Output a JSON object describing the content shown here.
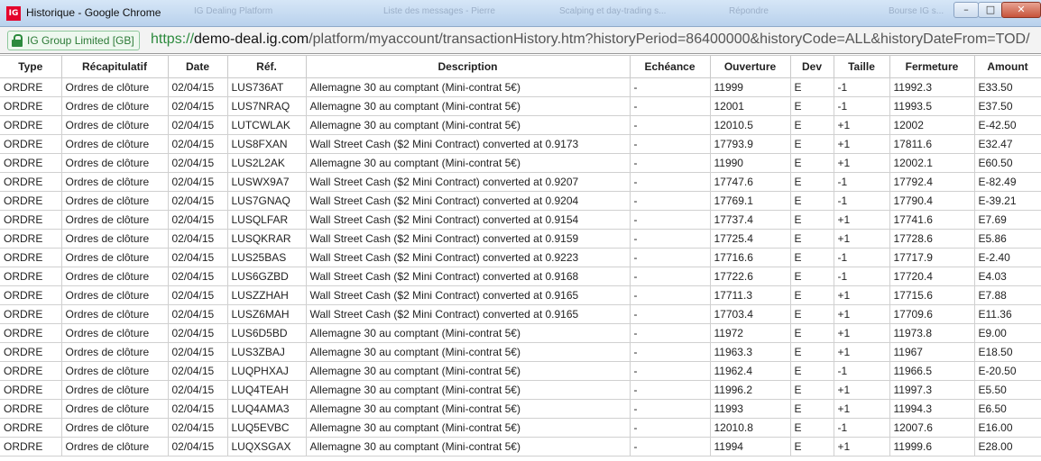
{
  "window": {
    "app_badge": "IG",
    "title": "Historique - Google Chrome",
    "ghost_tabs": [
      "IG Dealing Platform",
      "Liste des messages - Pierre",
      "Scalping et day-trading s...",
      "Répondre",
      "Bourse IG s..."
    ],
    "controls": {
      "minimize": "–",
      "maximize": "□",
      "close": "✕"
    }
  },
  "address_bar": {
    "secure_label": "IG Group Limited [GB]",
    "url_scheme": "https://",
    "url_host": "demo-deal.ig.com",
    "url_path": "/platform/myaccount/transactionHistory.htm?historyPeriod=86400000&historyCode=ALL&historyDateFrom=TOD/"
  },
  "table": {
    "headers": [
      "Type",
      "Récapitulatif",
      "Date",
      "Réf.",
      "Description",
      "Echéance",
      "Ouverture",
      "Dev",
      "Taille",
      "Fermeture",
      "Amount"
    ],
    "rows": [
      [
        "ORDRE",
        "Ordres de clôture",
        "02/04/15",
        "LUS736AT",
        "Allemagne 30 au comptant (Mini-contrat 5€)",
        "-",
        "11999",
        "E",
        "-1",
        "11992.3",
        "E33.50"
      ],
      [
        "ORDRE",
        "Ordres de clôture",
        "02/04/15",
        "LUS7NRAQ",
        "Allemagne 30 au comptant (Mini-contrat 5€)",
        "-",
        "12001",
        "E",
        "-1",
        "11993.5",
        "E37.50"
      ],
      [
        "ORDRE",
        "Ordres de clôture",
        "02/04/15",
        "LUTCWLAK",
        "Allemagne 30 au comptant (Mini-contrat 5€)",
        "-",
        "12010.5",
        "E",
        "+1",
        "12002",
        "E-42.50"
      ],
      [
        "ORDRE",
        "Ordres de clôture",
        "02/04/15",
        "LUS8FXAN",
        "Wall Street Cash ($2 Mini Contract) converted at 0.9173",
        "-",
        "17793.9",
        "E",
        "+1",
        "17811.6",
        "E32.47"
      ],
      [
        "ORDRE",
        "Ordres de clôture",
        "02/04/15",
        "LUS2L2AK",
        "Allemagne 30 au comptant (Mini-contrat 5€)",
        "-",
        "11990",
        "E",
        "+1",
        "12002.1",
        "E60.50"
      ],
      [
        "ORDRE",
        "Ordres de clôture",
        "02/04/15",
        "LUSWX9A7",
        "Wall Street Cash ($2 Mini Contract) converted at 0.9207",
        "-",
        "17747.6",
        "E",
        "-1",
        "17792.4",
        "E-82.49"
      ],
      [
        "ORDRE",
        "Ordres de clôture",
        "02/04/15",
        "LUS7GNAQ",
        "Wall Street Cash ($2 Mini Contract) converted at 0.9204",
        "-",
        "17769.1",
        "E",
        "-1",
        "17790.4",
        "E-39.21"
      ],
      [
        "ORDRE",
        "Ordres de clôture",
        "02/04/15",
        "LUSQLFAR",
        "Wall Street Cash ($2 Mini Contract) converted at 0.9154",
        "-",
        "17737.4",
        "E",
        "+1",
        "17741.6",
        "E7.69"
      ],
      [
        "ORDRE",
        "Ordres de clôture",
        "02/04/15",
        "LUSQKRAR",
        "Wall Street Cash ($2 Mini Contract) converted at 0.9159",
        "-",
        "17725.4",
        "E",
        "+1",
        "17728.6",
        "E5.86"
      ],
      [
        "ORDRE",
        "Ordres de clôture",
        "02/04/15",
        "LUS25BAS",
        "Wall Street Cash ($2 Mini Contract) converted at 0.9223",
        "-",
        "17716.6",
        "E",
        "-1",
        "17717.9",
        "E-2.40"
      ],
      [
        "ORDRE",
        "Ordres de clôture",
        "02/04/15",
        "LUS6GZBD",
        "Wall Street Cash ($2 Mini Contract) converted at 0.9168",
        "-",
        "17722.6",
        "E",
        "-1",
        "17720.4",
        "E4.03"
      ],
      [
        "ORDRE",
        "Ordres de clôture",
        "02/04/15",
        "LUSZZHAH",
        "Wall Street Cash ($2 Mini Contract) converted at 0.9165",
        "-",
        "17711.3",
        "E",
        "+1",
        "17715.6",
        "E7.88"
      ],
      [
        "ORDRE",
        "Ordres de clôture",
        "02/04/15",
        "LUSZ6MAH",
        "Wall Street Cash ($2 Mini Contract) converted at 0.9165",
        "-",
        "17703.4",
        "E",
        "+1",
        "17709.6",
        "E11.36"
      ],
      [
        "ORDRE",
        "Ordres de clôture",
        "02/04/15",
        "LUS6D5BD",
        "Allemagne 30 au comptant (Mini-contrat 5€)",
        "-",
        "11972",
        "E",
        "+1",
        "11973.8",
        "E9.00"
      ],
      [
        "ORDRE",
        "Ordres de clôture",
        "02/04/15",
        "LUS3ZBAJ",
        "Allemagne 30 au comptant (Mini-contrat 5€)",
        "-",
        "11963.3",
        "E",
        "+1",
        "11967",
        "E18.50"
      ],
      [
        "ORDRE",
        "Ordres de clôture",
        "02/04/15",
        "LUQPHXAJ",
        "Allemagne 30 au comptant (Mini-contrat 5€)",
        "-",
        "11962.4",
        "E",
        "-1",
        "11966.5",
        "E-20.50"
      ],
      [
        "ORDRE",
        "Ordres de clôture",
        "02/04/15",
        "LUQ4TEAH",
        "Allemagne 30 au comptant (Mini-contrat 5€)",
        "-",
        "11996.2",
        "E",
        "+1",
        "11997.3",
        "E5.50"
      ],
      [
        "ORDRE",
        "Ordres de clôture",
        "02/04/15",
        "LUQ4AMA3",
        "Allemagne 30 au comptant (Mini-contrat 5€)",
        "-",
        "11993",
        "E",
        "+1",
        "11994.3",
        "E6.50"
      ],
      [
        "ORDRE",
        "Ordres de clôture",
        "02/04/15",
        "LUQ5EVBC",
        "Allemagne 30 au comptant (Mini-contrat 5€)",
        "-",
        "12010.8",
        "E",
        "-1",
        "12007.6",
        "E16.00"
      ],
      [
        "ORDRE",
        "Ordres de clôture",
        "02/04/15",
        "LUQXSGAX",
        "Allemagne 30 au comptant (Mini-contrat 5€)",
        "-",
        "11994",
        "E",
        "+1",
        "11999.6",
        "E28.00"
      ]
    ]
  }
}
